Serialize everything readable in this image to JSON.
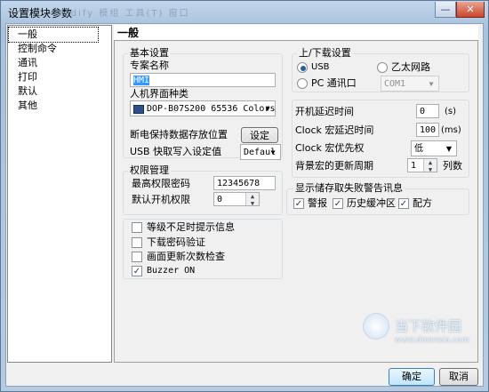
{
  "window": {
    "title": "设置模块参数",
    "ghost_menu": "Modify  模组  工具(T)  窗口"
  },
  "titlebar_buttons": {
    "minimize": "—",
    "close": "✕"
  },
  "nav": {
    "items": [
      {
        "label": "一般",
        "selected": true
      },
      {
        "label": "控制命令"
      },
      {
        "label": "通讯"
      },
      {
        "label": "打印"
      },
      {
        "label": "默认"
      },
      {
        "label": "其他"
      }
    ]
  },
  "section": {
    "title": "一般"
  },
  "basic": {
    "group_label": "基本设置",
    "project_name_label": "专案名称",
    "project_name_value": "HMI",
    "hmi_type_label": "人机界面种类",
    "hmi_type_value": "DOP-B07S200 65536 Colors",
    "power_loss_label": "断电保持数据存放位置",
    "power_loss_button": "设定",
    "usb_write_label": "USB 快取写入设定值",
    "usb_write_value": "Defaul"
  },
  "permission": {
    "group_label": "权限管理",
    "max_password_label": "最高权限密码",
    "max_password_value": "12345678",
    "default_level_label": "默认开机权限",
    "default_level_value": "0"
  },
  "options": [
    {
      "label": "等级不足时提示信息",
      "checked": false
    },
    {
      "label": "下载密码验证",
      "checked": false
    },
    {
      "label": "画面更新次数检查",
      "checked": false
    },
    {
      "label": "Buzzer ON",
      "checked": true
    }
  ],
  "updown": {
    "group_label": "上/下载设置",
    "usb_label": "USB",
    "usb_selected": true,
    "ethernet_label": "乙太网路",
    "pc_port_label": "PC 通讯口",
    "com_value": "COM1"
  },
  "timing": {
    "startup_delay_label": "开机延迟时间",
    "startup_delay_value": "0",
    "startup_delay_unit": "(s)",
    "clock_delay_label": "Clock 宏延迟时间",
    "clock_delay_value": "100",
    "clock_delay_unit": "(ms)",
    "clock_priority_label": "Clock 宏优先权",
    "clock_priority_value": "低",
    "bg_macro_label": "背景宏的更新周期",
    "bg_macro_value": "1",
    "bg_macro_unit": "列数"
  },
  "warn": {
    "group_label": "显示储存取失败警告讯息",
    "alarm_label": "警报",
    "alarm_checked": true,
    "history_label": "历史缓冲区",
    "history_checked": true,
    "recipe_label": "配方",
    "recipe_checked": true
  },
  "footer": {
    "ok": "确定",
    "cancel": "取消"
  },
  "watermark": {
    "line1": "当下软件园",
    "line2": "www.downxia.com"
  }
}
